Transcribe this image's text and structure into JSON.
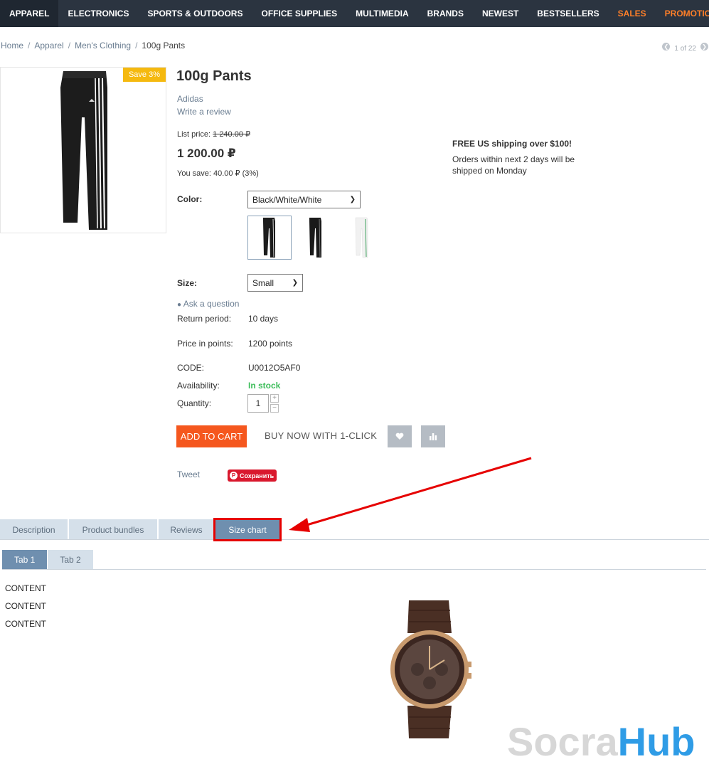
{
  "nav": {
    "items": [
      {
        "label": "APPAREL"
      },
      {
        "label": "ELECTRONICS"
      },
      {
        "label": "SPORTS & OUTDOORS"
      },
      {
        "label": "OFFICE SUPPLIES"
      },
      {
        "label": "MULTIMEDIA"
      },
      {
        "label": "BRANDS"
      },
      {
        "label": "NEWEST"
      },
      {
        "label": "BESTSELLERS"
      },
      {
        "label": "SALES"
      },
      {
        "label": "PROMOTIONS"
      }
    ],
    "accent_color": "#ff7f28"
  },
  "breadcrumb": {
    "home": "Home",
    "apparel": "Apparel",
    "mens": "Men's Clothing",
    "current": "100g Pants",
    "sep": "/"
  },
  "pager": {
    "text": "1 of 22"
  },
  "product": {
    "save_badge": "Save 3%",
    "title": "100g Pants",
    "brand": "Adidas",
    "write_review": "Write a review",
    "list_price_label": "List price:",
    "list_price": "1 240.00 ₽",
    "price": "1 200.00 ₽",
    "you_save": "You save: 40.00 ₽ (3%)"
  },
  "shipping": {
    "title": "FREE US shipping over $100!",
    "text": "Orders within next 2 days will be shipped on Monday"
  },
  "options": {
    "color_label": "Color:",
    "color_value": "Black/White/White",
    "size_label": "Size:",
    "size_value": "Small"
  },
  "info": {
    "ask": "Ask a question",
    "return_label": "Return period:",
    "return_value": "10 days",
    "points_label": "Price in points:",
    "points_value": "1200 points",
    "code_label": "CODE:",
    "code_value": "U0012O5AF0",
    "avail_label": "Availability:",
    "avail_value": "In stock",
    "qty_label": "Quantity:",
    "qty_value": "1"
  },
  "actions": {
    "add_to_cart": "ADD TO CART",
    "buy_now": "BUY NOW WITH 1-CLICK"
  },
  "social": {
    "tweet": "Tweet",
    "pin": "Сохранить"
  },
  "tabs": [
    {
      "label": "Description"
    },
    {
      "label": "Product bundles"
    },
    {
      "label": "Reviews"
    },
    {
      "label": "Size chart"
    }
  ],
  "subtabs": [
    {
      "label": "Tab 1"
    },
    {
      "label": "Tab 2"
    }
  ],
  "content_lines": [
    "CONTENT",
    "CONTENT",
    "CONTENT"
  ],
  "watermark": {
    "part1": "Socra",
    "part2": "Hub"
  }
}
